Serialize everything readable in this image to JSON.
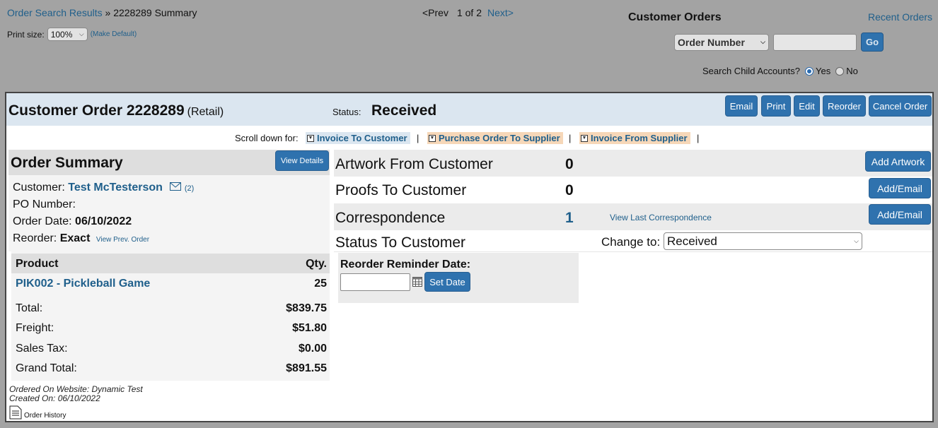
{
  "breadcrumb": {
    "link": "Order Search Results",
    "separator": "»",
    "current": "2228289 Summary"
  },
  "print_size": {
    "label": "Print size:",
    "value": "100%",
    "make_default": "(Make Default)"
  },
  "pager": {
    "prev": "<Prev",
    "position": "1 of 2",
    "next": "Next>"
  },
  "customer_orders": {
    "title": "Customer Orders",
    "recent": "Recent Orders",
    "search_type": "Order Number",
    "search_value": "",
    "go": "Go",
    "child_label": "Search Child Accounts?",
    "yes": "Yes",
    "no": "No",
    "child_selected": "Yes"
  },
  "order": {
    "title": "Customer Order 2228289",
    "type": "(Retail)",
    "status_label": "Status:",
    "status": "Received",
    "buttons": {
      "email": "Email",
      "print": "Print",
      "edit": "Edit",
      "reorder": "Reorder",
      "cancel": "Cancel Order"
    }
  },
  "scroll": {
    "label": "Scroll down for:",
    "links": [
      "Invoice To Customer",
      "Purchase Order To Supplier",
      "Invoice From Supplier"
    ],
    "separator": "|"
  },
  "summary": {
    "title": "Order Summary",
    "view_details": "View Details",
    "customer_label": "Customer:",
    "customer": "Test McTesterson",
    "msg_count": "(2)",
    "po_label": "PO Number:",
    "po_value": "",
    "date_label": "Order Date:",
    "date": "06/10/2022",
    "reorder_label": "Reorder:",
    "reorder": "Exact",
    "view_prev": "View Prev. Order",
    "product_header": "Product",
    "qty_header": "Qty.",
    "products": [
      {
        "name": "PIK002 - Pickleball Game",
        "qty": "25"
      }
    ],
    "totals": [
      {
        "label": "Total:",
        "value": "$839.75"
      },
      {
        "label": "Freight:",
        "value": "$51.80"
      },
      {
        "label": "Sales Tax:",
        "value": "$0.00"
      },
      {
        "label": "Grand Total:",
        "value": "$891.55"
      }
    ],
    "website": "Ordered On Website: Dynamic Test",
    "created": "Created On: 06/10/2022",
    "history": "Order History"
  },
  "sections": {
    "artwork": {
      "label": "Artwork From Customer",
      "count": "0",
      "button": "Add Artwork"
    },
    "proofs": {
      "label": "Proofs To Customer",
      "count": "0",
      "button": "Add/Email"
    },
    "corr": {
      "label": "Correspondence",
      "count": "1",
      "link": "View Last Correspondence",
      "button": "Add/Email"
    },
    "status": {
      "label": "Status To Customer",
      "change_label": "Change to:",
      "value": "Received"
    }
  },
  "reminder": {
    "label": "Reorder Reminder Date:",
    "value": "",
    "button": "Set Date"
  },
  "colors": {
    "accent": "#2f72ae",
    "link": "#1f5f8b",
    "header_bg": "#dbe6f0",
    "chip_bg": "#f6d7b8"
  }
}
